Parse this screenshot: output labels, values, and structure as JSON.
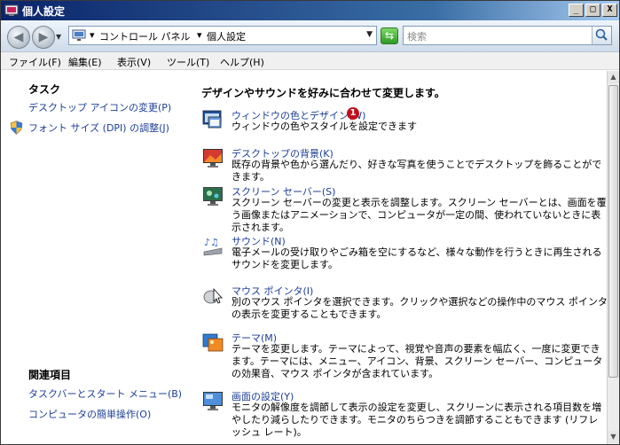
{
  "window": {
    "title": "個人設定",
    "minimize": "_",
    "maximize": "□",
    "close": "X"
  },
  "nav": {
    "back": "◀",
    "forward": "▶",
    "dropdown": "▼"
  },
  "address": {
    "crumb_sep1": "▾",
    "crumb1": "コントロール パネル",
    "crumb_sep2": "▾",
    "crumb2": "個人設定",
    "dropdown": "▼"
  },
  "refresh": "⇆",
  "search": {
    "placeholder": "検索"
  },
  "menu": [
    "ファイル(F)",
    "編集(E)",
    "表示(V)",
    "ツール(T)",
    "ヘルプ(H)"
  ],
  "sidebar": {
    "tasks_heading": "タスク",
    "tasks": [
      "デスクトップ アイコンの変更(P)",
      "フォント サイズ (DPI) の調整(J)"
    ],
    "related_heading": "関連項目",
    "related": [
      "タスクバーとスタート メニュー(B)",
      "コンピュータの簡単操作(O)"
    ]
  },
  "main": {
    "heading": "デザインやサウンドを好みに合わせて変更します。",
    "items": [
      {
        "icon": "window-color-icon",
        "link": "ウィンドウの色とデザイン(W)",
        "desc": "ウィンドウの色やスタイルを設定できます"
      },
      {
        "icon": "desktop-background-icon",
        "link": "デスクトップの背景(K)",
        "desc": "既存の背景や色から選んだり、好きな写真を使うことでデスクトップを飾ることができます。"
      },
      {
        "icon": "screensaver-icon",
        "link": "スクリーン セーバー(S)",
        "desc": "スクリーン セーバーの変更と表示を調整します。スクリーン セーバーとは、画面を覆う画像またはアニメーションで、コンピュータが一定の間、使われていないときに表示されます。"
      },
      {
        "icon": "sound-icon",
        "link": "サウンド(N)",
        "desc": "電子メールの受け取りやごみ箱を空にするなど、様々な動作を行うときに再生されるサウンドを変更します。"
      },
      {
        "icon": "mouse-pointer-icon",
        "link": "マウス ポインタ(I)",
        "desc": "別のマウス ポインタを選択できます。クリックや選択などの操作中のマウス ポインタの表示を変更することもできます。"
      },
      {
        "icon": "theme-icon",
        "link": "テーマ(M)",
        "desc": "テーマを変更します。テーマによって、視覚や音声の要素を幅広く、一度に変更できます。テーマには、メニュー、アイコン、背景、スクリーン セーバー、コンピュータの効果音、マウス ポインタが含まれています。"
      },
      {
        "icon": "display-settings-icon",
        "link": "画面の設定(Y)",
        "desc": "モニタの解像度を調節して表示の設定を変更し、スクリーンに表示される項目数を増やしたり減らしたりできます。モニタのちらつきを調節することもできます (リフレッシュ レート)。"
      }
    ],
    "badge": "1"
  },
  "scroll": {
    "up": "▲",
    "down": "▼"
  }
}
